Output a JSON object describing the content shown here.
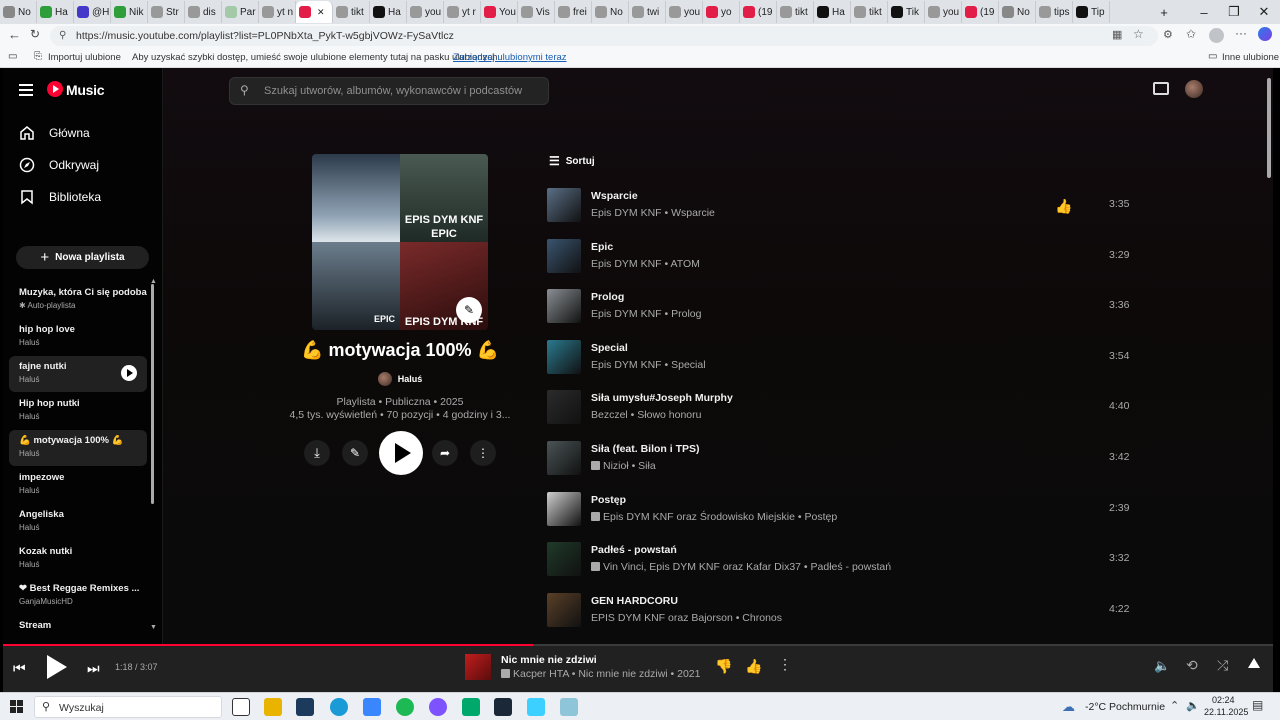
{
  "browser": {
    "tabs": [
      "No",
      "Ha",
      "@H",
      "Nik",
      "Str",
      "dis",
      "Par",
      "yt n",
      "",
      "tikt",
      "Ha",
      "you",
      "yt r",
      "You",
      "Vis",
      "frei",
      "No",
      "twi",
      "you",
      "yo",
      "(19",
      "tikt",
      "Ha",
      "tikt",
      "Tik",
      "you",
      "(19",
      "No",
      "tips",
      "Tip"
    ],
    "url": "https://music.youtube.com/playlist?list=PL0PNbXta_PykT-w5gbjVOWz-FySaVtlcz",
    "bookmarks_import": "Importuj ulubione",
    "bookmarks_hint": "Aby uzyskać szybki dostęp, umieść swoje ulubione elementy tutaj na pasku ulubionych.",
    "bookmarks_manage": "Zarządzaj ulubionymi teraz",
    "bookmarks_other": "Inne ulubione"
  },
  "app": {
    "logo": "Music",
    "search_placeholder": "Szukaj utworów, albumów, wykonawców i podcastów",
    "nav": [
      "Główna",
      "Odkrywaj",
      "Biblioteka"
    ],
    "new_playlist": "Nowa playlista",
    "playlists": [
      {
        "title": "Muzyka, która Ci się podoba",
        "sub": "✱ Auto-playlista"
      },
      {
        "title": "hip hop love",
        "sub": "Haluś"
      },
      {
        "title": "fajne nutki",
        "sub": "Haluś"
      },
      {
        "title": "Hip hop nutki",
        "sub": "Haluś"
      },
      {
        "title": "💪 motywacja 100% 💪",
        "sub": "Haluś"
      },
      {
        "title": "impezowe",
        "sub": "Haluś"
      },
      {
        "title": "Angeliska",
        "sub": "Haluś"
      },
      {
        "title": "Kozak nutki",
        "sub": "Haluś"
      },
      {
        "title": "❤ Best Reggae Remixes ...",
        "sub": "GanjaMusicHD"
      },
      {
        "title": "Stream",
        "sub": ""
      }
    ]
  },
  "playlist": {
    "title": "💪 motywacja 100% 💪",
    "owner": "Haluś",
    "meta1": "Playlista • Publiczna • 2025",
    "meta2": "4,5 tys. wyświetleń • 70 pozycji • 4 godziny i 3...",
    "cover_texts": [
      "EPIS DYM KNF",
      "EPIC",
      "EPIS DYM KNF",
      "EPIC"
    ],
    "sort_label": "Sortuj"
  },
  "tracks": [
    {
      "title": "Wsparcie",
      "artist": "Epis DYM KNF • Wsparcie",
      "duration": "3:35",
      "explicit": false,
      "color": "#5a6f86"
    },
    {
      "title": "Epic",
      "artist": "Epis DYM KNF • ATOM",
      "duration": "3:29",
      "explicit": false,
      "color": "#3a5570"
    },
    {
      "title": "Prolog",
      "artist": "Epis DYM KNF • Prolog",
      "duration": "3:36",
      "explicit": false,
      "color": "#8a8f94"
    },
    {
      "title": "Special",
      "artist": "Epis DYM KNF • Special",
      "duration": "3:54",
      "explicit": false,
      "color": "#2a7a8f"
    },
    {
      "title": "Siła umysłu#Joseph Murphy",
      "artist": "Bezczel • Słowo honoru",
      "duration": "4:40",
      "explicit": false,
      "color": "#2b2b2b"
    },
    {
      "title": "Siła (feat. Bilon i TPS)",
      "artist": "Nizioł • Siła",
      "duration": "3:42",
      "explicit": true,
      "color": "#4a5456"
    },
    {
      "title": "Postęp",
      "artist": "Epis DYM KNF oraz Środowisko Miejskie • Postęp",
      "duration": "2:39",
      "explicit": true,
      "color": "#cfcfcf"
    },
    {
      "title": "Padłeś - powstań",
      "artist": "Vin Vinci, Epis DYM KNF oraz Kafar Dix37 • Padłeś - powstań",
      "duration": "3:32",
      "explicit": true,
      "color": "#1f3a2a"
    },
    {
      "title": "GEN HARDCORU",
      "artist": "EPIS DYM KNF oraz Bajorson • Chronos",
      "duration": "4:22",
      "explicit": false,
      "color": "#5a4028"
    }
  ],
  "player": {
    "time": "1:18 / 3:07",
    "progress": 0.417,
    "title": "Nic mnie nie zdziwi",
    "artist": "Kacper HTA • Nic mnie nie zdziwi • 2021"
  },
  "taskbar": {
    "search": "Wyszukaj",
    "weather": "-2°C",
    "weather_desc": "Pochmurnie",
    "time": "02:24",
    "date": "22.11.2025"
  },
  "colors": {
    "accent": "#ff0033",
    "bg": "#030303",
    "player": "#212121"
  }
}
